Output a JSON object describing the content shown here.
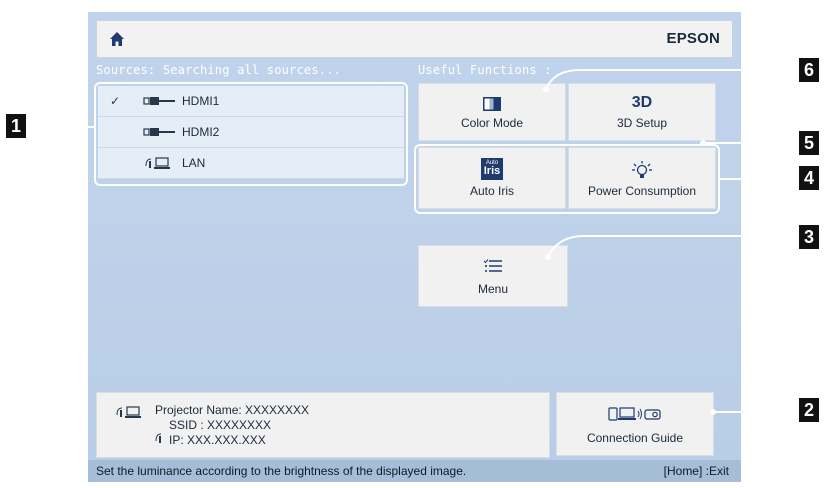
{
  "header": {
    "home_icon": "home-icon",
    "brand": "EPSON"
  },
  "sources": {
    "label": "Sources: Searching all sources...",
    "items": [
      {
        "label": "HDMI1",
        "selected": true,
        "icon": "hdmi-icon"
      },
      {
        "label": "HDMI2",
        "selected": false,
        "icon": "hdmi-icon"
      },
      {
        "label": "LAN",
        "selected": false,
        "icon": "lan-icon"
      }
    ]
  },
  "useful": {
    "label": "Useful Functions :",
    "color_mode": "Color Mode",
    "setup_3d": "3D Setup",
    "auto_iris": "Auto Iris",
    "power_consumption": "Power Consumption",
    "menu": "Menu",
    "icon_3d_text": "3D",
    "icon_iris_text_small": "Auto",
    "icon_iris_text_big": "Iris"
  },
  "info": {
    "projector_name": "Projector Name:  XXXXXXXX",
    "ssid": "SSID :  XXXXXXXX",
    "ip": "IP:  XXX.XXX.XXX"
  },
  "connection_guide": "Connection Guide",
  "status": {
    "text": "Set the luminance according to the brightness of the displayed image.",
    "exit": "[Home] :Exit"
  },
  "callouts": [
    "1",
    "2",
    "3",
    "4",
    "5",
    "6"
  ],
  "colors": {
    "background": "#bfd3ec",
    "statusbar": "#a6bdd8",
    "tile": "#f1f1f1",
    "badge": "#111111"
  }
}
